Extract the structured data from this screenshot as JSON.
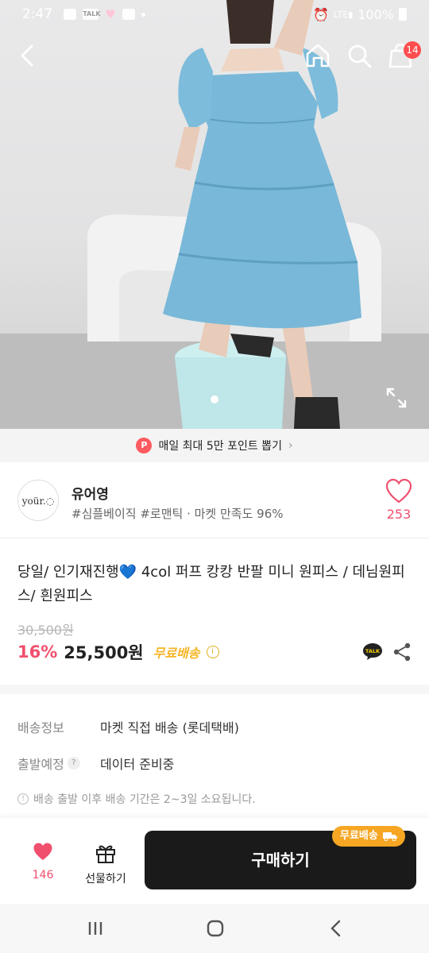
{
  "status_bar": {
    "time": "2:47",
    "battery": "100%",
    "talk_icon": "TALK"
  },
  "header": {
    "cart_count": "14",
    "icons": [
      "back-icon",
      "home-icon",
      "search-icon",
      "cart-icon"
    ]
  },
  "promo": {
    "icon_letter": "P",
    "text": "매일 최대 5만 포인트 뽑기",
    "chevron": "›"
  },
  "seller": {
    "logo_text": "yoür.◌",
    "name": "유어영",
    "tags": "#심플베이직 #로맨틱 · 마켓 만족도 96%",
    "like_count": "253"
  },
  "product": {
    "title": "당일/ 인기재진행💙 4col 퍼프 캉캉 반팔 미니 원피스 / 데님원피스/ 흰원피스",
    "original_price": "30,500원",
    "discount": "16%",
    "price": "25,500원",
    "shipping_badge": "무료배송",
    "info_glyph": "i"
  },
  "shipping": {
    "info_label": "배송정보",
    "info_value": "마켓 직접 배송 (롯데택배)",
    "departure_label": "출발예정",
    "departure_help": "?",
    "departure_value": "데이터 준비중",
    "note_glyph": "!",
    "note": "배송 출발 이후 배송 기간은 2~3일 소요됩니다."
  },
  "action_bar": {
    "like_count": "146",
    "gift_label": "선물하기",
    "buy_label": "구매하기",
    "free_tag": "무료배송"
  },
  "colors": {
    "accent_pink": "#f0506e",
    "free_yellow": "#f6b526",
    "buy_black": "#1a1a1a"
  }
}
